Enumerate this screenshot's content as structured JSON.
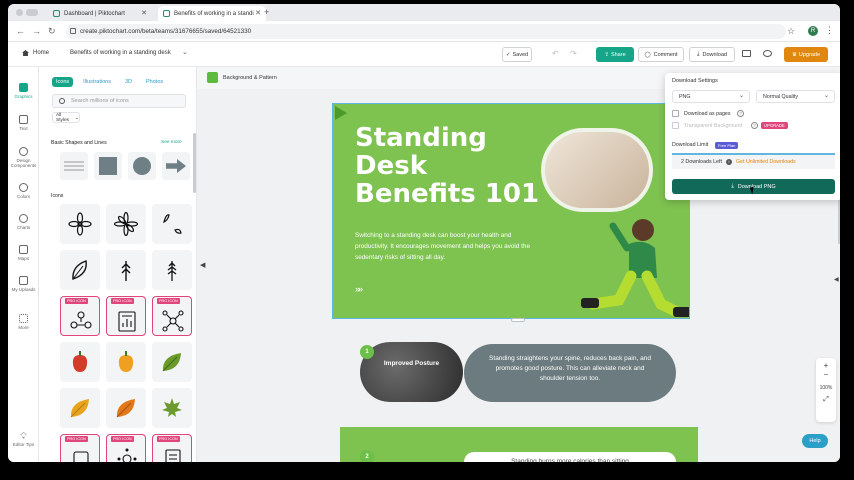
{
  "browser": {
    "tabs": [
      {
        "title": "Dashboard | Piktochart"
      },
      {
        "title": "Benefits of working in a standi"
      }
    ],
    "url": "create.piktochart.com/beta/teams/31676655/saved/64521330",
    "profile_initial": "R"
  },
  "toolbar": {
    "home_label": "Home",
    "doc_title": "Benefits of working in a standing desk",
    "saved_label": "Saved",
    "share_label": "Share",
    "comment_label": "Comment",
    "download_label": "Download",
    "upgrade_label": "Upgrade"
  },
  "rail": {
    "items": [
      {
        "label": "Graphics",
        "active": true
      },
      {
        "label": "Text"
      },
      {
        "label": "Design Components"
      },
      {
        "label": "Colors"
      },
      {
        "label": "Charts"
      },
      {
        "label": "Maps"
      },
      {
        "label": "My Uploads"
      },
      {
        "label": "More"
      }
    ],
    "editor_tips_label": "Editor Tips"
  },
  "panel": {
    "tabs": [
      "Icons",
      "Illustrations",
      "3D",
      "Photos"
    ],
    "active_tab": "Icons",
    "search_placeholder": "Search millions of icons",
    "style_filter": "All Styles",
    "basic_header": "Basic Shapes and Lines",
    "see_more": "See more",
    "icons_header": "Icons",
    "pro_badge": "PRO ICON"
  },
  "canvas": {
    "bg_label": "Background & Pattern",
    "page_title": "Standing Desk Benefits 101",
    "page_body": "Switching to a standing desk can boost your health and productivity. It encourages movement and helps you avoid the sedentary risks of sitting all day.",
    "arrows": "»»",
    "section1_number": "1",
    "section1_label": "Improved Posture",
    "section1_text": "Standing straightens your spine, reduces back pain, and promotes good posture. This can alleviate neck and shoulder tension too.",
    "section2_number": "2",
    "section2_text": "Standing burns more calories than sitting"
  },
  "zoom": {
    "plus": "+",
    "minus": "−",
    "level": "100%"
  },
  "help_label": "Help",
  "download_panel": {
    "header": "Download Settings",
    "format": "PNG",
    "quality": "Normal Quality",
    "as_pages_label": "Download as pages",
    "transparent_label": "Transparent Background",
    "upgrade_badge": "UPGRADE",
    "limit_label": "Download Limit",
    "plan_badge": "Free Plan",
    "downloads_left": "2 Downloads Left",
    "get_unlimited": "Get Unlimited Downloads",
    "button_label": "Download PNG"
  },
  "colors": {
    "accent": "#17a589",
    "canvas_green": "#7ec250",
    "pro_pink": "#e0457b",
    "upgrade_orange": "#e0870f",
    "dark_teal": "#11695a"
  }
}
